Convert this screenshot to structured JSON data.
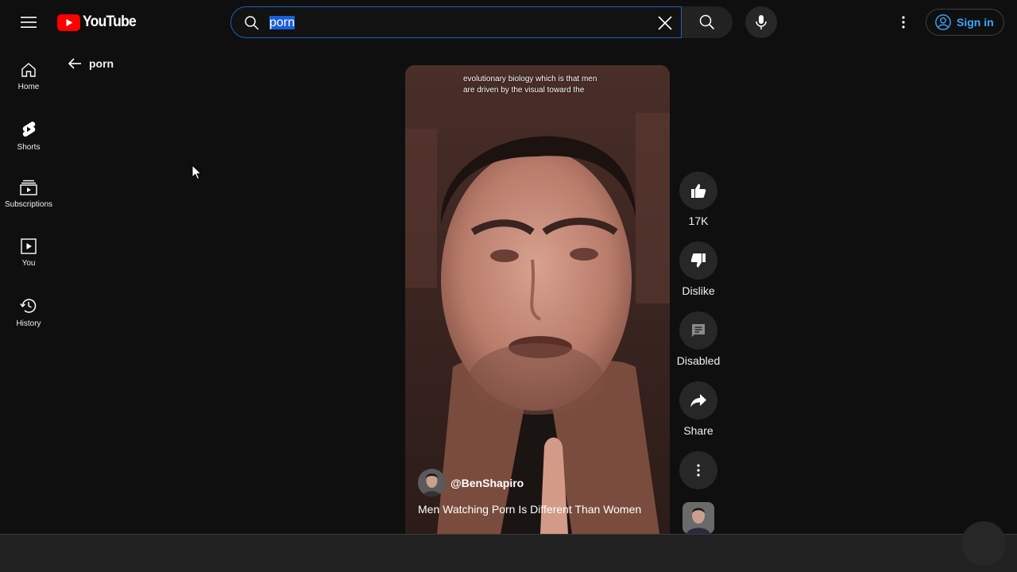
{
  "header": {
    "logo_text": "YouTube",
    "search_value": "porn",
    "sign_in_label": "Sign in"
  },
  "sidebar": {
    "items": [
      {
        "label": "Home",
        "icon": "home-icon"
      },
      {
        "label": "Shorts",
        "icon": "shorts-icon"
      },
      {
        "label": "Subscriptions",
        "icon": "subscriptions-icon"
      },
      {
        "label": "You",
        "icon": "you-icon"
      },
      {
        "label": "History",
        "icon": "history-icon"
      }
    ]
  },
  "back": {
    "query": "porn"
  },
  "short": {
    "caption_line1": "evolutionary biology which is that men",
    "caption_line2": "are driven by the visual toward the",
    "channel_handle": "@BenShapiro",
    "title": "Men Watching Porn Is Different Than Women"
  },
  "actions": {
    "like_count": "17K",
    "dislike_label": "Dislike",
    "comments_label": "Disabled",
    "share_label": "Share"
  },
  "colors": {
    "accent_blue": "#3ea6ff",
    "logo_red": "#ff0000",
    "background": "#0f0f0f"
  }
}
